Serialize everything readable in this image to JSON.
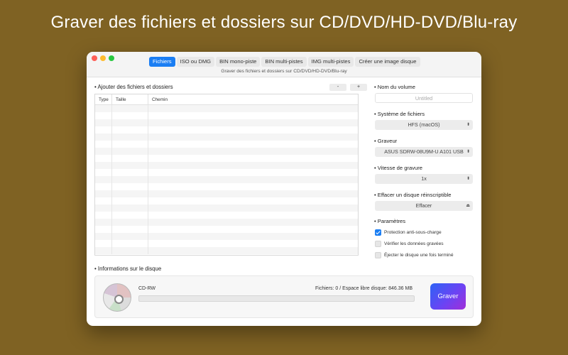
{
  "headline": "Graver des fichiers et dossiers sur CD/DVD/HD-DVD/Blu-ray",
  "tabs": [
    {
      "label": "Fichiers",
      "active": true
    },
    {
      "label": "ISO ou DMG",
      "active": false
    },
    {
      "label": "BIN mono-piste",
      "active": false
    },
    {
      "label": "BIN multi-pistes",
      "active": false
    },
    {
      "label": "IMG multi-pistes",
      "active": false
    },
    {
      "label": "Créer une image disque",
      "active": false
    }
  ],
  "subtitle": "Graver des fichiers et dossiers sur CD/DVD/HD-DVD/Blu-ray",
  "files": {
    "title": "Ajouter des fichiers et dossiers",
    "remove_label": "-",
    "add_label": "+",
    "columns": [
      "Type",
      "Taille",
      "Chemin"
    ],
    "rows": []
  },
  "volume": {
    "label": "Nom du volume",
    "placeholder": "Untitled"
  },
  "filesystem": {
    "label": "Système de fichiers",
    "value": "HFS  (macOS)"
  },
  "burner": {
    "label": "Graveur",
    "value": "ASUS SDRW-08U9M-U A101 USB"
  },
  "speed": {
    "label": "Vitesse de gravure",
    "value": "1x"
  },
  "erase": {
    "label": "Effacer un disque réinscriptible",
    "button": "Effacer"
  },
  "params": {
    "label": "Paramètres",
    "options": [
      {
        "label": "Protection anti-sous-charge",
        "checked": true
      },
      {
        "label": "Vérifier les données gravées",
        "checked": false
      },
      {
        "label": "Éjecter le disque une fois terminé",
        "checked": false
      }
    ]
  },
  "disc_info": {
    "title": "Informations sur le disque",
    "disc_type": "CD-RW",
    "stats": "Fichiers: 0 / Espace libre disque: 846.36 MB",
    "progress": 0
  },
  "burn_button": "Graver",
  "colors": {
    "accent": "#1b7ef3",
    "background": "#7f6223"
  }
}
